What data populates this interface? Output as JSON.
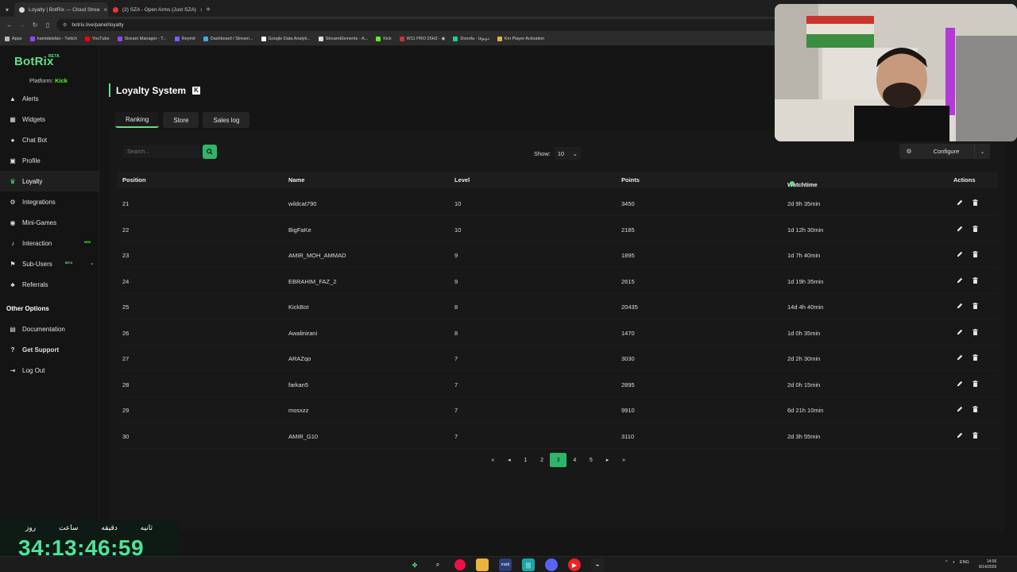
{
  "browser": {
    "tabs": [
      {
        "title": "Loyalty | BotRix — Cloud Strea",
        "active": true
      },
      {
        "title": "(2) SZA - Open Arms (Just SZA)",
        "active": false
      }
    ],
    "url": "botrix.live/panel/loyalty",
    "bookmarks": [
      "Apps",
      "hamidstefan - Twitch",
      "YouTube",
      "Stream Manager - T...",
      "Reymit",
      "Dashboard / Stream...",
      "Google Data Analyti...",
      "StreamElements - A...",
      "Kick",
      "W11 PRO 25H2 - ◉",
      "Donofa - دونوفا",
      "Km Player Activation"
    ]
  },
  "sidebar": {
    "logo": "BotRix",
    "logo_badge": "BETA",
    "platform_label": "Platform:",
    "platform_value": "Kick",
    "items": [
      {
        "label": "Alerts",
        "icon": "warning-icon"
      },
      {
        "label": "Widgets",
        "icon": "grid-icon"
      },
      {
        "label": "Chat Bot",
        "icon": "chat-icon"
      },
      {
        "label": "Profile",
        "icon": "profile-icon"
      },
      {
        "label": "Loyalty",
        "icon": "trophy-icon",
        "active": true
      },
      {
        "label": "Integrations",
        "icon": "integrations-icon"
      },
      {
        "label": "Mini-Games",
        "icon": "gamepad-icon"
      },
      {
        "label": "Interaction",
        "icon": "music-icon",
        "badge": "NEW"
      },
      {
        "label": "Sub-Users",
        "icon": "users-icon",
        "badge": "BETA"
      },
      {
        "label": "Referrals",
        "icon": "referrals-icon"
      }
    ],
    "other_heading": "Other Options",
    "other_items": [
      {
        "label": "Documentation",
        "icon": "book-icon"
      },
      {
        "label": "Get Support",
        "icon": "question-icon"
      },
      {
        "label": "Log Out",
        "icon": "logout-icon"
      }
    ]
  },
  "timer": {
    "labels": [
      "روز",
      "ساعت",
      "دقیقه",
      "ثانیه"
    ],
    "value": "34:13:46:59"
  },
  "page": {
    "title": "Loyalty System",
    "tabs": [
      "Ranking",
      "Store",
      "Sales log"
    ],
    "search_placeholder": "Search...",
    "show_label": "Show:",
    "show_value": "10",
    "configure_label": "Configure"
  },
  "table": {
    "headers": [
      "Position",
      "Name",
      "Level",
      "Points",
      "Watchtime",
      "Actions"
    ],
    "rows": [
      {
        "position": "21",
        "name": "wildcat790",
        "level": "10",
        "points": "3450",
        "watchtime": "2d 9h 35min"
      },
      {
        "position": "22",
        "name": "BigFaKe",
        "level": "10",
        "points": "2185",
        "watchtime": "1d 12h 30min"
      },
      {
        "position": "23",
        "name": "AMIR_MOH_AMMAD",
        "level": "9",
        "points": "1895",
        "watchtime": "1d 7h 40min"
      },
      {
        "position": "24",
        "name": "EBRAHIM_FAZ_2",
        "level": "9",
        "points": "2615",
        "watchtime": "1d 19h 35min"
      },
      {
        "position": "25",
        "name": "KickBot",
        "level": "8",
        "points": "20435",
        "watchtime": "14d 4h 40min"
      },
      {
        "position": "26",
        "name": "Awalinirani",
        "level": "8",
        "points": "1470",
        "watchtime": "1d 0h 35min"
      },
      {
        "position": "27",
        "name": "ARAZqo",
        "level": "7",
        "points": "3030",
        "watchtime": "2d 2h 30min"
      },
      {
        "position": "28",
        "name": "farkan5",
        "level": "7",
        "points": "2895",
        "watchtime": "2d 0h 15min"
      },
      {
        "position": "29",
        "name": "mosxzz",
        "level": "7",
        "points": "9910",
        "watchtime": "6d 21h 10min"
      },
      {
        "position": "30",
        "name": "AMIR_G10",
        "level": "7",
        "points": "3110",
        "watchtime": "2d 3h 55min"
      }
    ]
  },
  "pagination": {
    "pages": [
      "1",
      "2",
      "3",
      "4",
      "5"
    ],
    "current": "3"
  },
  "taskbar": {
    "lang": "ENG",
    "time": "14:06",
    "date": "8/14/2026"
  },
  "colors": {
    "accent": "#5fe088",
    "kick_green": "#53fc18",
    "button_green": "#2fb56a"
  }
}
